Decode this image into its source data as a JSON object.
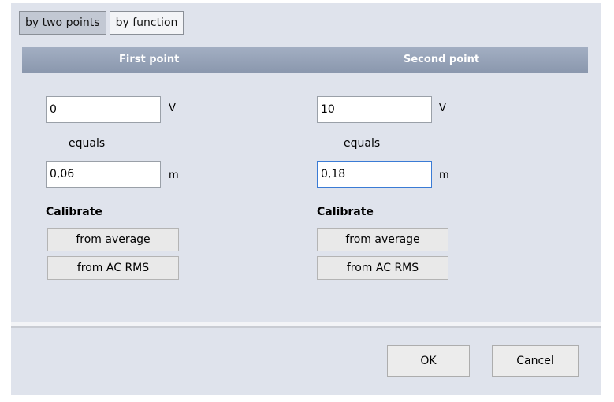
{
  "tabs": [
    {
      "label": "by two points",
      "active": true
    },
    {
      "label": "by function",
      "active": false
    }
  ],
  "header": {
    "first_point": "First point",
    "second_point": "Second point"
  },
  "first_point": {
    "input_value": "0",
    "input_unit": "V",
    "equals": "equals",
    "output_value": "0,06",
    "output_unit": "m",
    "calibrate_label": "Calibrate",
    "from_average": "from average",
    "from_ac_rms": "from AC RMS"
  },
  "second_point": {
    "input_value": "10",
    "input_unit": "V",
    "equals": "equals",
    "output_value": "0,18",
    "output_unit": "m",
    "calibrate_label": "Calibrate",
    "from_average": "from average",
    "from_ac_rms": "from AC RMS"
  },
  "buttons": {
    "ok": "OK",
    "cancel": "Cancel"
  }
}
